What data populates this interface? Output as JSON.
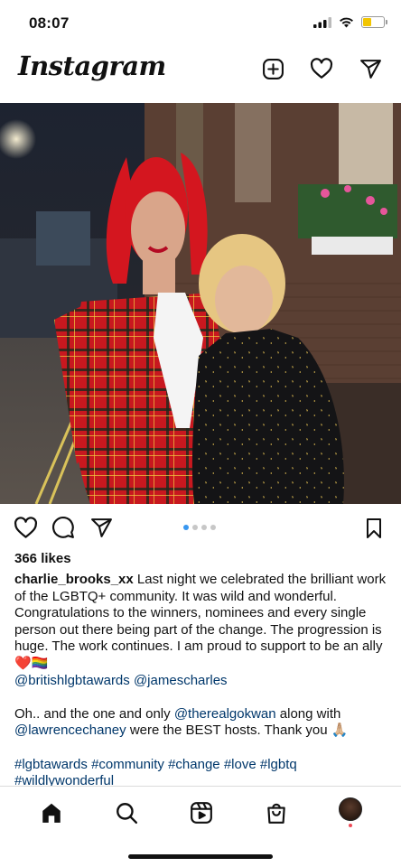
{
  "status_bar": {
    "time": "08:07"
  },
  "header": {
    "logo": "Instagram"
  },
  "post": {
    "carousel": {
      "total": 4,
      "active_index": 0
    },
    "likes": "366 likes",
    "caption": {
      "username": "charlie_brooks_xx",
      "text": "Last night we celebrated the brilliant work of the LGBTQ+ community. It was wild and wonderful. Congratulations to the winners, nominees and every single person out there being part of the change. The progression is huge. The work continues. I am proud to support to be an ally",
      "emojis": "❤️🏳️‍🌈",
      "mentions": [
        "@britishlgbtawards",
        "@jamescharles"
      ],
      "para2_prefix": "Oh.. and the one and only",
      "para2_mention1": "@therealgokwan",
      "para2_mid": "along with",
      "para2_mention2": "@lawrencechaney",
      "para2_suffix": "were the BEST hosts. Thank you 🙏🏼",
      "hashtags": [
        "#lgbtawards",
        "#community",
        "#change",
        "#love",
        "#lgbtq",
        "#wildlywonderful"
      ]
    }
  },
  "colors": {
    "link": "#00376b",
    "active_dot": "#3897f0",
    "battery": "#f2c500"
  }
}
